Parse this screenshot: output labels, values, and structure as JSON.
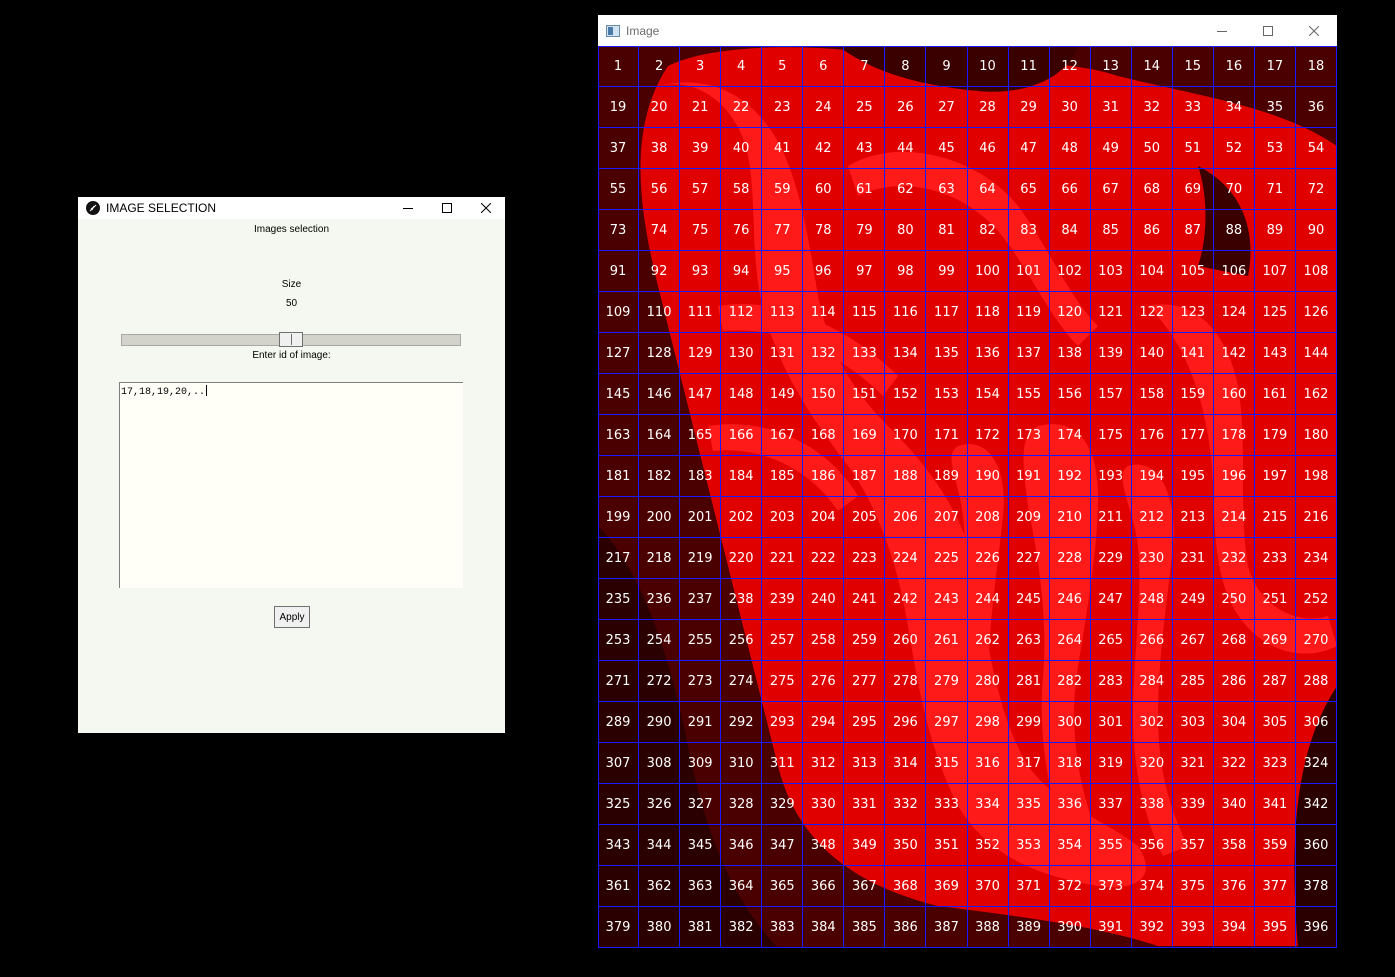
{
  "selection_window": {
    "title": "IMAGE SELECTION",
    "heading": "Images selection",
    "size_label": "Size",
    "size_value": 50,
    "size_min": 0,
    "size_max": 100,
    "size_value_text": "50",
    "id_label": "Enter id of image:",
    "id_input_value": "17,18,19,20,..",
    "apply_label": "Apply",
    "icon": "feather-app-icon"
  },
  "image_window": {
    "title": "Image",
    "icon": "image-window-icon",
    "grid_columns": 18,
    "grid_rows": 22,
    "grid_line_color": "#1a1aff",
    "label_color": "#ffffff",
    "tissue_color": "#ff0000",
    "background_color": "#3a0000",
    "first_cell_id": 1,
    "last_cell_id": 396
  },
  "controls": {
    "minimize": "minimize-icon",
    "maximize": "maximize-icon",
    "close": "close-icon"
  }
}
